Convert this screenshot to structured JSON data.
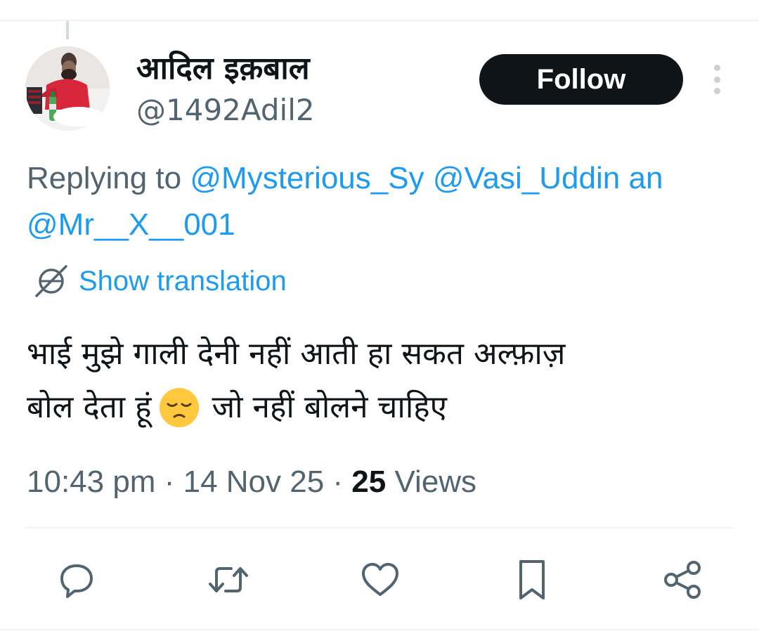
{
  "author": {
    "display_name": "आदिल इक़बाल",
    "handle": "@1492Adil2"
  },
  "header": {
    "follow_label": "Follow"
  },
  "reply": {
    "prefix": "Replying to",
    "mentions": [
      "@Mysterious_Sy",
      "@Vasi_Uddin",
      "an",
      "@Mr__X__001"
    ]
  },
  "translate": {
    "label": "Show translation"
  },
  "tweet": {
    "line1": "भाई मुझे गाली देनी नहीं आती हा सकत अल्फ़ाज़",
    "line2_before": "बोल देता हूं",
    "line2_after": "जो नहीं बोलने चाहिए",
    "emoji": "disappointed-face"
  },
  "meta": {
    "time": "10:43 pm",
    "sep1": "·",
    "date": "14 Nov 25",
    "sep2": "·",
    "views_count": "25",
    "views_label": "Views"
  },
  "actions": [
    {
      "name": "reply",
      "icon": "speech-bubble-icon"
    },
    {
      "name": "retweet",
      "icon": "retweet-icon"
    },
    {
      "name": "like",
      "icon": "heart-icon"
    },
    {
      "name": "bookmark",
      "icon": "bookmark-icon"
    },
    {
      "name": "share",
      "icon": "share-icon"
    }
  ],
  "colors": {
    "text": "#0f1419",
    "secondary": "#536471",
    "link": "#1d9bf0",
    "button": "#0f1419",
    "icon": "#536471"
  }
}
